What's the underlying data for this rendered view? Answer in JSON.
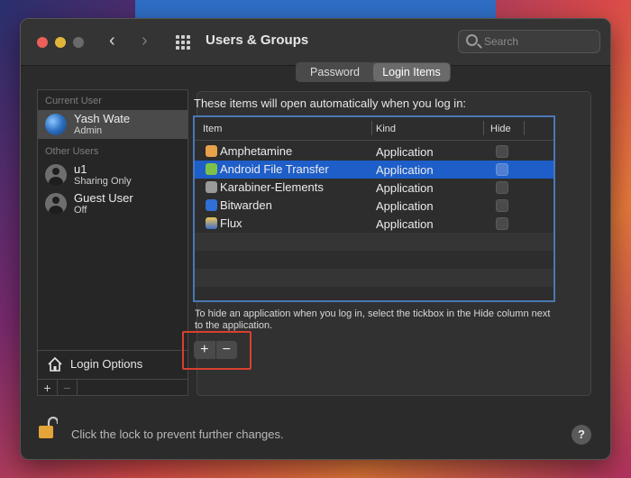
{
  "window": {
    "title": "Users & Groups",
    "search_placeholder": "Search"
  },
  "sidebar": {
    "current_user_label": "Current User",
    "other_users_label": "Other Users",
    "users": [
      {
        "name": "Yash Wate",
        "role": "Admin"
      },
      {
        "name": "u1",
        "role": "Sharing Only"
      },
      {
        "name": "Guest User",
        "role": "Off"
      }
    ],
    "login_options_label": "Login Options",
    "add_label": "+",
    "remove_label": "−"
  },
  "tabs": [
    {
      "label": "Password",
      "active": false
    },
    {
      "label": "Login Items",
      "active": true
    }
  ],
  "login_items": {
    "intro": "These items will open automatically when you log in:",
    "columns": {
      "item": "Item",
      "kind": "Kind",
      "hide": "Hide"
    },
    "rows": [
      {
        "name": "Amphetamine",
        "kind": "Application",
        "hide": false,
        "selected": false
      },
      {
        "name": "Android File Transfer",
        "kind": "Application",
        "hide": false,
        "selected": true
      },
      {
        "name": "Karabiner-Elements",
        "kind": "Application",
        "hide": false,
        "selected": false
      },
      {
        "name": "Bitwarden",
        "kind": "Application",
        "hide": false,
        "selected": false
      },
      {
        "name": "Flux",
        "kind": "Application",
        "hide": false,
        "selected": false
      }
    ],
    "hint": "To hide an application when you log in, select the tickbox in the Hide column next to the application.",
    "add_label": "+",
    "remove_label": "−"
  },
  "footer": {
    "lock_text": "Click the lock to prevent further changes.",
    "help_label": "?"
  }
}
